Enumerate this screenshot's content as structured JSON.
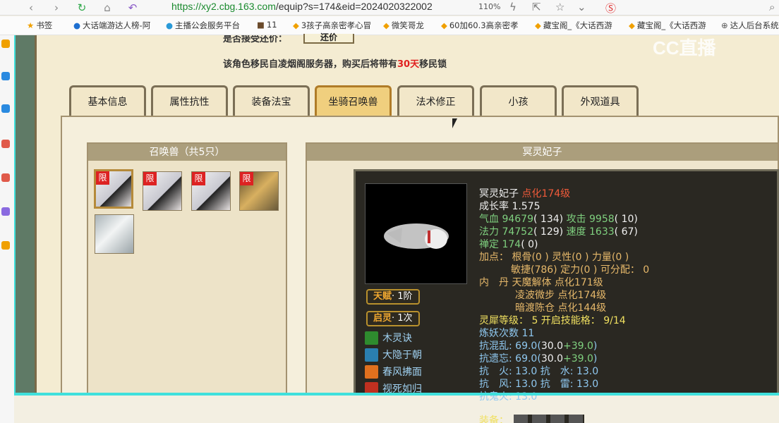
{
  "browser": {
    "url_host": "https://xy2.cbg.163.com",
    "url_path": "/equip?s=174&eid=2024020322002",
    "zoom": "110%",
    "bookmarks": [
      {
        "label": "书签"
      },
      {
        "label": "大话端游达人榜-阿"
      },
      {
        "label": "主播公会服务平台"
      },
      {
        "label": "11"
      },
      {
        "label": "3孩子高亲密孝心冒"
      },
      {
        "label": "微笑哥龙"
      },
      {
        "label": "60加60.3高亲密孝"
      },
      {
        "label": "藏宝阁_《大话西游"
      },
      {
        "label": "藏宝阁_《大话西游"
      },
      {
        "label": "达人后台系统"
      }
    ]
  },
  "notice": {
    "line1": "是否接受还价：",
    "bargain_button": "还价",
    "line2_prefix": "该角色移民自凌烟阁服务器，购买后将带有",
    "line2_days": "30天",
    "line2_suffix": "移民锁"
  },
  "tabs": [
    {
      "label": "基本信息"
    },
    {
      "label": "属性抗性"
    },
    {
      "label": "装备法宝"
    },
    {
      "label": "坐骑召唤兽",
      "active": true
    },
    {
      "label": "法术修正"
    },
    {
      "label": "小孩"
    },
    {
      "label": "外观道具"
    }
  ],
  "summons_panel": {
    "title": "召唤兽（共5只）",
    "limit_label": "限"
  },
  "detail_panel": {
    "title": "冥灵妃子",
    "name": "冥灵妃子",
    "dianhua": "点化174级",
    "growth_label": "成长率",
    "growth": "1.575",
    "hp_label": "气血",
    "hp": "94679",
    "hp_extra": "( 134)",
    "atk_label": "攻击",
    "atk": "9958",
    "atk_extra": "( 10)",
    "mp_label": "法力",
    "mp": "74752",
    "mp_extra": "( 129)",
    "spd_label": "速度",
    "spd": "1633",
    "spd_extra": "( 67)",
    "chanding_label": "禅定",
    "chanding": "174",
    "chanding_extra": "( 0)",
    "points_label": "加点：",
    "points_line1": "根骨(0 ) 灵性(0 ) 力量(0 )",
    "points_line2": "敏捷(786) 定力(0 ) 可分配：",
    "points_free": "0",
    "neidan_label": "内　丹",
    "neidan": [
      {
        "name": "天魔解体",
        "level": "点化171级"
      },
      {
        "name": "凌波微步",
        "level": "点化174级"
      },
      {
        "name": "暗渡陈仓",
        "level": "点化144级"
      }
    ],
    "lingxi_label": "灵犀等级：",
    "lingxi": "5 开启技能格：",
    "lingxi_slots": "9/14",
    "lianyao": "炼妖次数 11",
    "kang1_label": "抗混乱:",
    "kang1_base": "69.0(",
    "kang1_a": "30.0",
    "kang1_b": "+39.0",
    "kang1_end": ")",
    "kang2_label": "抗遗忘:",
    "kang2_base": "69.0(",
    "kang2_a": "30.0",
    "kang2_b": "+39.0",
    "kang2_end": ")",
    "kang3": "抗　火: 13.0 抗　水: 13.0",
    "kang4": "抗　风: 13.0 抗　雷: 13.0",
    "kang5": "抗鬼火: 13.0",
    "equip_label": "装备：",
    "talent_label": "天赋",
    "talent_value": "· 1阶",
    "qiling_label": "启灵",
    "qiling_value": "· 1次",
    "skills": [
      {
        "name": "木灵诀",
        "color": "#2e8b2e"
      },
      {
        "name": "大隐于朝",
        "color": "#2a7fb0"
      },
      {
        "name": "春风拂面",
        "color": "#e0701e"
      },
      {
        "name": "视死如归",
        "color": "#c03020"
      }
    ]
  },
  "overlay": {
    "logo": "CC直播"
  }
}
